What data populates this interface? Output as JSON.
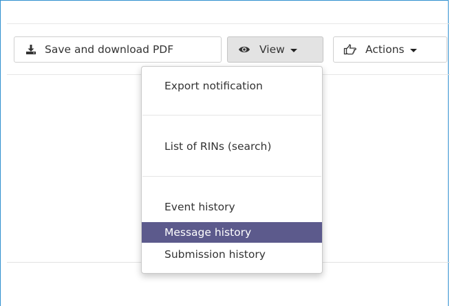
{
  "toolbar": {
    "save_label": "Save and download PDF",
    "view_label": "View",
    "actions_label": "Actions"
  },
  "view_menu": {
    "items": [
      {
        "label": "Export notification"
      },
      {
        "label": "List of RINs (search)"
      },
      {
        "label": "Event history"
      },
      {
        "label": "Message history"
      },
      {
        "label": "Submission history"
      }
    ],
    "active_item": "Message history"
  },
  "colors": {
    "frame_border": "#2e8fcf",
    "menu_highlight": "#5c5a8c",
    "view_button_bg": "#e3e3e3"
  },
  "icons": {
    "save": "download-icon",
    "view": "eye-icon",
    "actions": "hand-pointing-icon"
  }
}
